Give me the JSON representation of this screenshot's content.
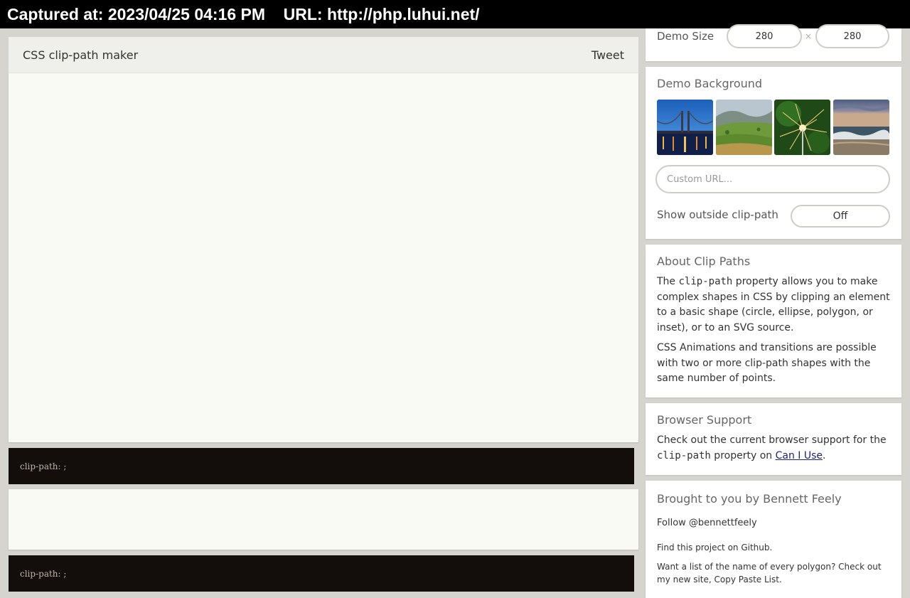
{
  "capture": {
    "text": "Captured at: 2023/04/25 04:16 PM    URL: http://php.luhui.net/"
  },
  "header": {
    "title": "CSS clip-path maker",
    "tweet": "Tweet"
  },
  "code": {
    "text": "clip-path: ;"
  },
  "demo_size": {
    "label": "Demo Size",
    "width": "280",
    "times": "×",
    "height": "280"
  },
  "background": {
    "title": "Demo Background",
    "custom_url_placeholder": "Custom URL...",
    "thumbnails": [
      "bridge-night-image",
      "green-hills-image",
      "sparkler-image",
      "ocean-waves-image"
    ]
  },
  "outside": {
    "label": "Show outside clip-path",
    "value": "Off"
  },
  "about": {
    "title": "About Clip Paths",
    "p1_pre": "The ",
    "p1_code": "clip-path",
    "p1_post": " property allows you to make complex shapes in CSS by clipping an element to a basic shape (circle, ellipse, polygon, or inset), or to an SVG source.",
    "p2": "CSS Animations and transitions are possible with two or more clip-path shapes with the same number of points."
  },
  "support": {
    "title": "Browser Support",
    "pre": "Check out the current browser support for the ",
    "code": "clip-path",
    "mid": " property on ",
    "link": "Can I Use",
    "post": "."
  },
  "credits": {
    "title": "Brought to you by Bennett Feely",
    "follow": "Follow @bennettfeely",
    "find": "Find this project on Github.",
    "want": "Want a list of the name of every polygon? Check out my new site, Copy Paste List."
  }
}
